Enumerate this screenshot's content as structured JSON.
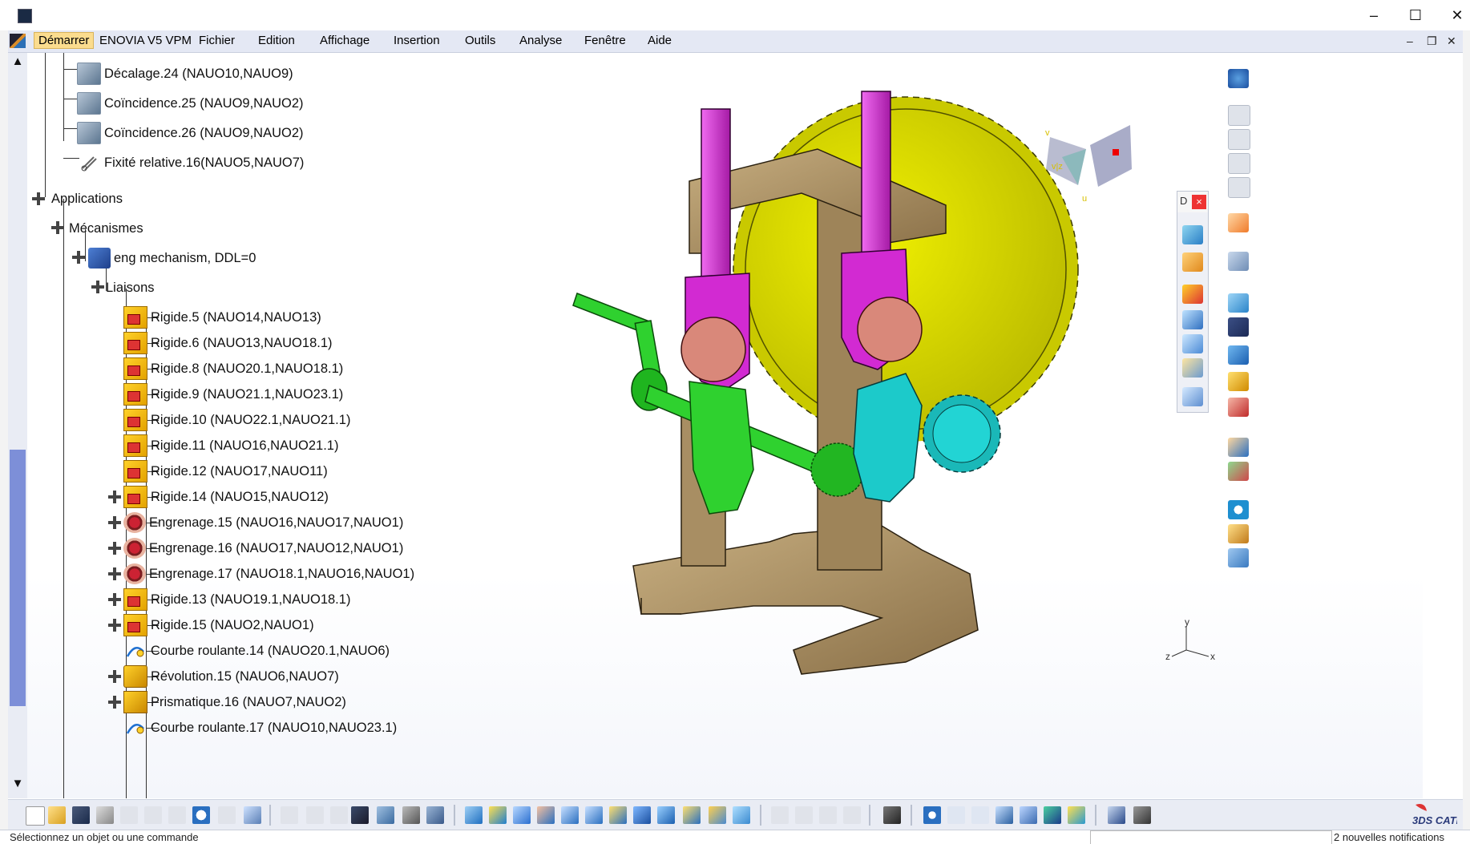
{
  "window": {
    "title": "",
    "min_glyph": "–",
    "max_glyph": "☐",
    "close_glyph": "✕"
  },
  "menu": {
    "items": [
      {
        "label": "Démarrer",
        "active": true
      },
      {
        "label": "ENOVIA V5 VPM"
      },
      {
        "label": "Fichier"
      },
      {
        "label": "Edition"
      },
      {
        "label": "Affichage"
      },
      {
        "label": "Insertion"
      },
      {
        "label": "Outils"
      },
      {
        "label": "Analyse"
      },
      {
        "label": "Fenêtre"
      },
      {
        "label": "Aide"
      }
    ],
    "mdi_min": "–",
    "mdi_restore": "❐",
    "mdi_close": "✕"
  },
  "tree": {
    "nodes": [
      {
        "label": "Décalage.24 (NAUO10,NAUO9)",
        "icon": "offset-constraint-icon"
      },
      {
        "label": "Coïncidence.25 (NAUO9,NAUO2)",
        "icon": "coincidence-constraint-icon"
      },
      {
        "label": "Coïncidence.26 (NAUO9,NAUO2)",
        "icon": "coincidence-constraint-icon"
      },
      {
        "label": "Fixité relative.16(NAUO5,NAUO7)",
        "icon": "fix-together-icon"
      },
      {
        "label": "Applications",
        "icon": ""
      },
      {
        "label": "Mécanismes",
        "icon": ""
      },
      {
        "label": "eng mechanism, DDL=0",
        "icon": "mechanism-icon"
      },
      {
        "label": "Liaisons",
        "icon": ""
      },
      {
        "label": "Rigide.5 (NAUO14,NAUO13)",
        "icon": "rigid-joint-icon"
      },
      {
        "label": "Rigide.6 (NAUO13,NAUO18.1)",
        "icon": "rigid-joint-icon"
      },
      {
        "label": "Rigide.8 (NAUO20.1,NAUO18.1)",
        "icon": "rigid-joint-icon"
      },
      {
        "label": "Rigide.9 (NAUO21.1,NAUO23.1)",
        "icon": "rigid-joint-icon"
      },
      {
        "label": "Rigide.10 (NAUO22.1,NAUO21.1)",
        "icon": "rigid-joint-icon"
      },
      {
        "label": "Rigide.11 (NAUO16,NAUO21.1)",
        "icon": "rigid-joint-icon"
      },
      {
        "label": "Rigide.12 (NAUO17,NAUO11)",
        "icon": "rigid-joint-icon"
      },
      {
        "label": "Rigide.14 (NAUO15,NAUO12)",
        "icon": "rigid-joint-icon"
      },
      {
        "label": "Engrenage.15 (NAUO16,NAUO17,NAUO1)",
        "icon": "gear-joint-icon"
      },
      {
        "label": "Engrenage.16 (NAUO17,NAUO12,NAUO1)",
        "icon": "gear-joint-icon"
      },
      {
        "label": "Engrenage.17 (NAUO18.1,NAUO16,NAUO1)",
        "icon": "gear-joint-icon"
      },
      {
        "label": "Rigide.13 (NAUO19.1,NAUO18.1)",
        "icon": "rigid-joint-icon"
      },
      {
        "label": "Rigide.15 (NAUO2,NAUO1)",
        "icon": "rigid-joint-icon"
      },
      {
        "label": "Courbe roulante.14 (NAUO20.1,NAUO6)",
        "icon": "roll-curve-joint-icon"
      },
      {
        "label": "Révolution.15 (NAUO6,NAUO7)",
        "icon": "revolute-joint-icon"
      },
      {
        "label": "Prismatique.16 (NAUO7,NAUO2)",
        "icon": "prismatic-joint-icon"
      },
      {
        "label": "Courbe roulante.17 (NAUO10,NAUO23.1)",
        "icon": "roll-curve-joint-icon"
      }
    ]
  },
  "compass": {
    "v_label": "v",
    "vz_label": "v|z",
    "u_label": "u"
  },
  "axis": {
    "x": "x",
    "y": "y",
    "z": "z"
  },
  "float_toolbar": {
    "title": "D",
    "close": "×"
  },
  "status": {
    "message": "Sélectionnez un objet ou une commande",
    "notifications": "2 nouvelles notifications"
  },
  "colors": {
    "gear_yellow": "#d9d900",
    "magenta": "#e03be0",
    "green": "#2fd12f",
    "cyan": "#1ccaca",
    "tan": "#a58d63",
    "salmon": "#d9887a",
    "menu_bg": "#e4e8f4"
  }
}
